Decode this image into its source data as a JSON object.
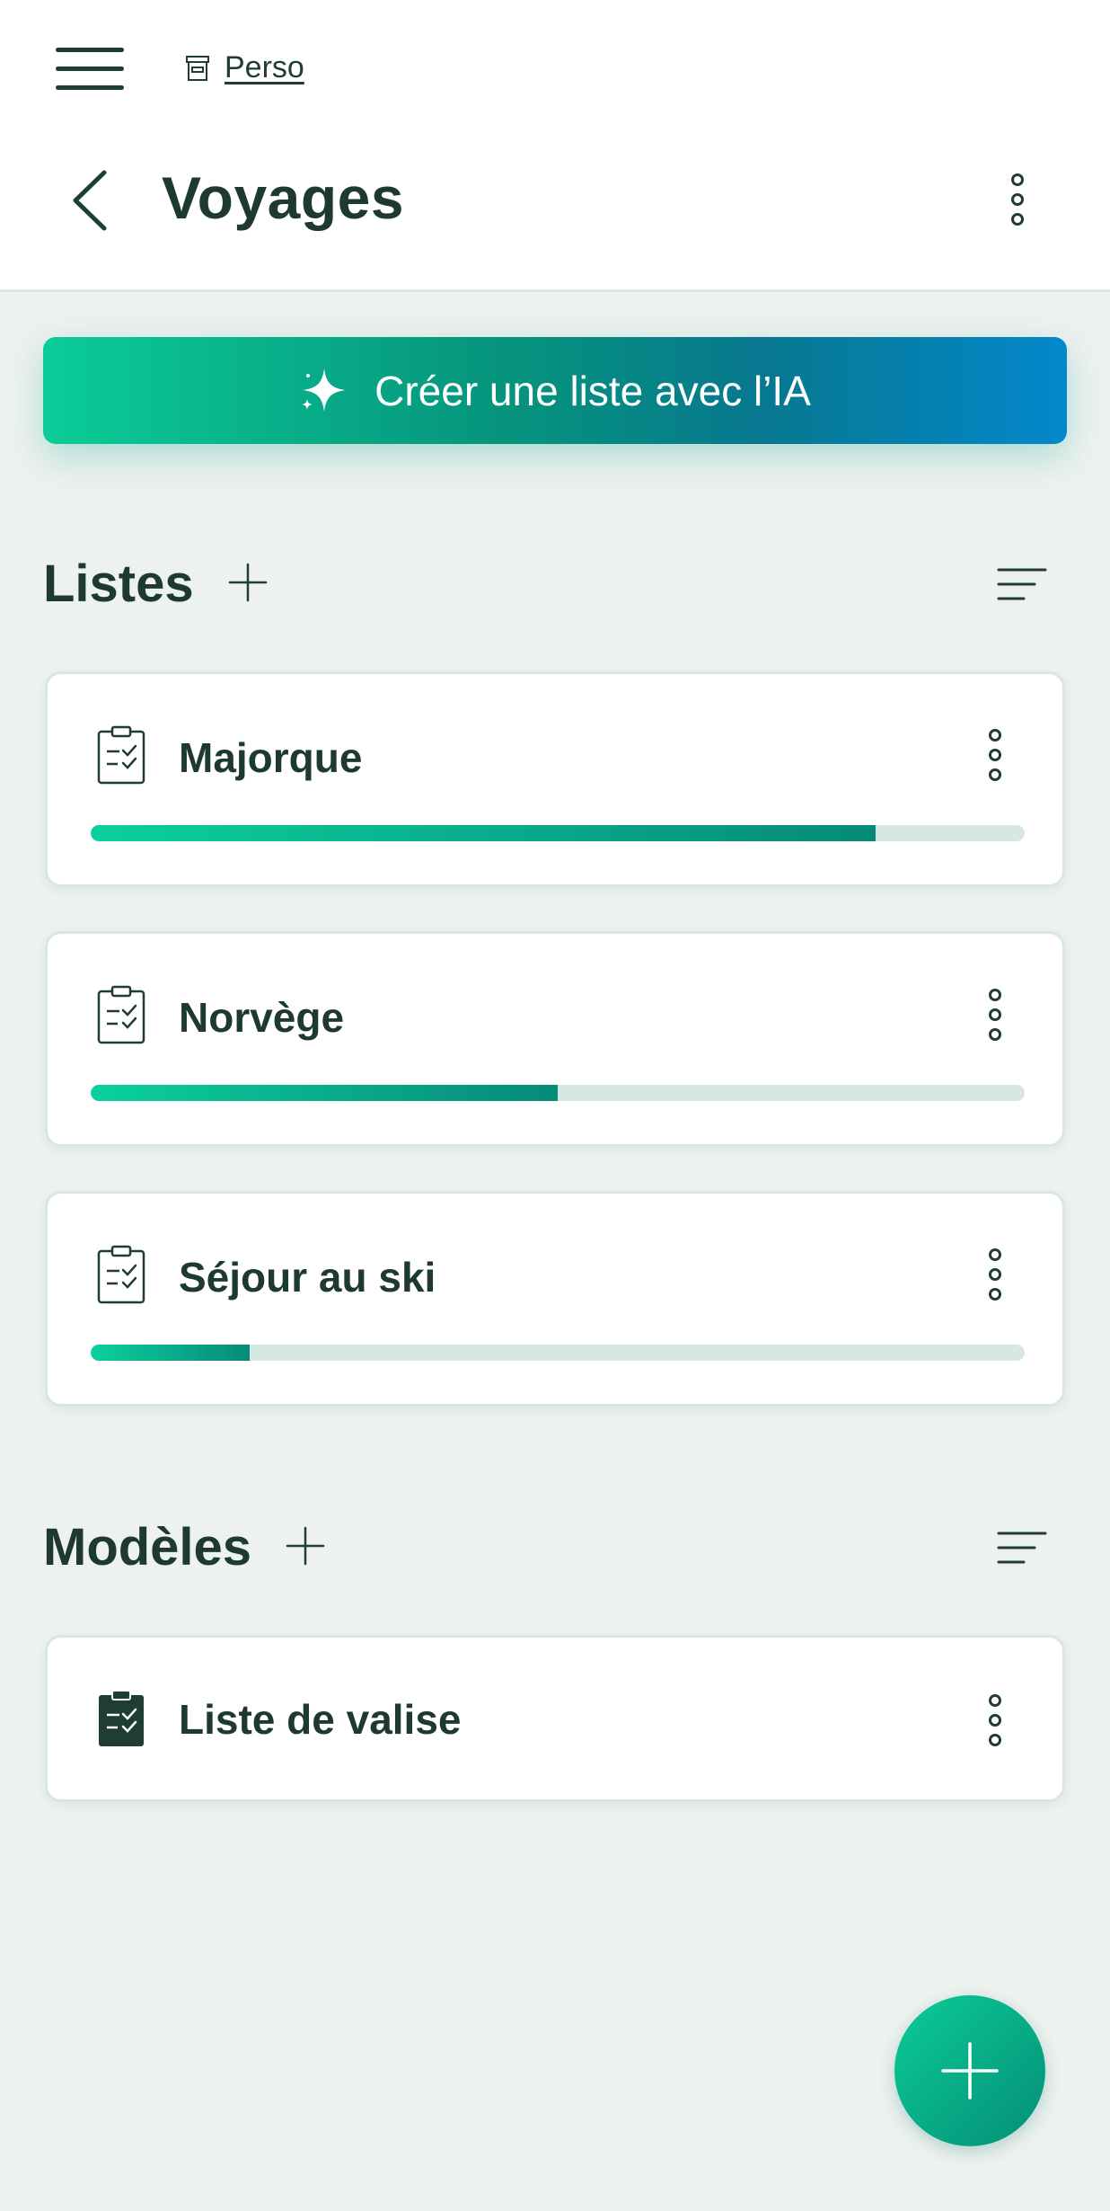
{
  "header": {
    "breadcrumb": "Perso",
    "title": "Voyages",
    "menu_icon": "hamburger-menu-icon",
    "breadcrumb_icon": "archive-box-icon",
    "back_icon": "chevron-left-icon",
    "more_icon": "vertical-dots-icon"
  },
  "ai_button": {
    "label": "Créer une liste avec l’IA",
    "icon": "sparkle-icon",
    "gradient": [
      "#0bcc98",
      "#06947c",
      "#07788f",
      "#0388cb"
    ]
  },
  "lists_section": {
    "title": "Listes",
    "add_icon": "plus-icon",
    "sort_icon": "sort-lines-icon",
    "items": [
      {
        "title": "Majorque",
        "progress": 0.84,
        "icon": "clipboard-checklist-icon"
      },
      {
        "title": "Norvège",
        "progress": 0.5,
        "icon": "clipboard-checklist-icon"
      },
      {
        "title": "Séjour au ski",
        "progress": 0.17,
        "icon": "clipboard-checklist-icon"
      }
    ]
  },
  "templates_section": {
    "title": "Modèles",
    "add_icon": "plus-icon",
    "sort_icon": "sort-lines-icon",
    "items": [
      {
        "title": "Liste de valise",
        "icon": "clipboard-checklist-filled-icon"
      }
    ]
  },
  "fab": {
    "icon": "plus-icon"
  },
  "colors": {
    "background": "#edf1ef",
    "primary_dark": "#1e3a2f",
    "accent": "#0bcc98",
    "accent_dark": "#058e77",
    "progress_track": "#d6e9e0",
    "card_border": "#d8e8e1"
  }
}
